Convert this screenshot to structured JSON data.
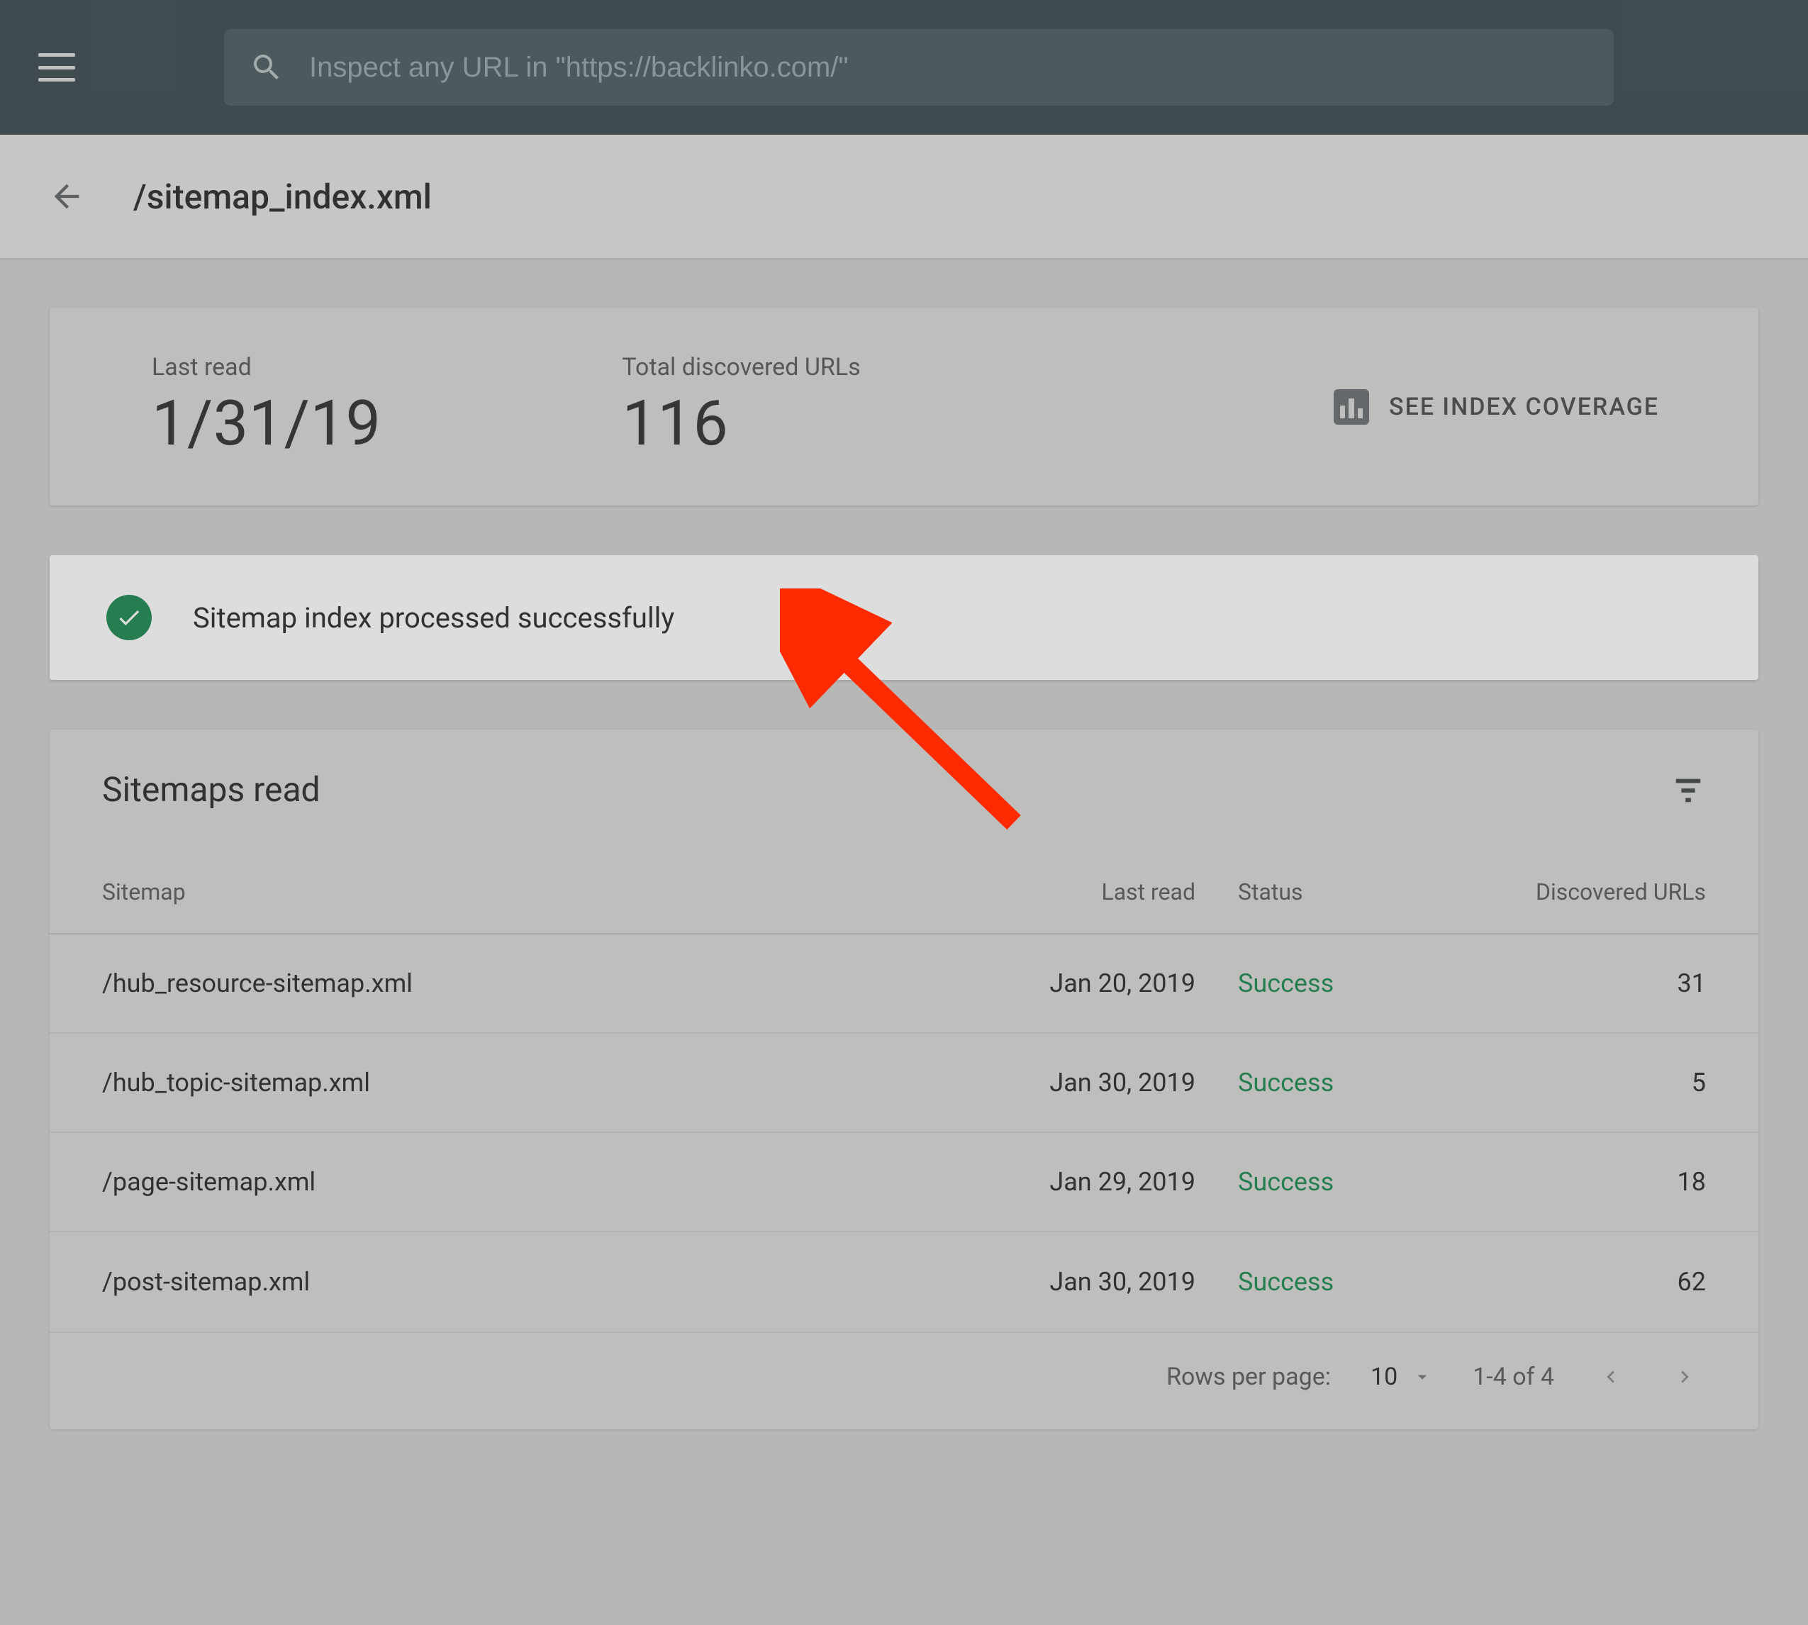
{
  "header": {
    "search_placeholder": "Inspect any URL in \"https://backlinko.com/\""
  },
  "subbar": {
    "title": "/sitemap_index.xml"
  },
  "summary": {
    "last_read_label": "Last read",
    "last_read_value": "1/31/19",
    "total_label": "Total discovered URLs",
    "total_value": "116",
    "coverage_label": "SEE INDEX COVERAGE"
  },
  "status_banner": {
    "text": "Sitemap index processed successfully"
  },
  "table": {
    "title": "Sitemaps read",
    "columns": {
      "sitemap": "Sitemap",
      "last_read": "Last read",
      "status": "Status",
      "discovered": "Discovered URLs"
    },
    "rows": [
      {
        "sitemap": "/hub_resource-sitemap.xml",
        "last_read": "Jan 20, 2019",
        "status": "Success",
        "discovered": "31"
      },
      {
        "sitemap": "/hub_topic-sitemap.xml",
        "last_read": "Jan 30, 2019",
        "status": "Success",
        "discovered": "5"
      },
      {
        "sitemap": "/page-sitemap.xml",
        "last_read": "Jan 29, 2019",
        "status": "Success",
        "discovered": "18"
      },
      {
        "sitemap": "/post-sitemap.xml",
        "last_read": "Jan 30, 2019",
        "status": "Success",
        "discovered": "62"
      }
    ],
    "footer": {
      "rows_per_page_label": "Rows per page:",
      "rows_per_page_value": "10",
      "range_label": "1-4 of 4"
    }
  }
}
